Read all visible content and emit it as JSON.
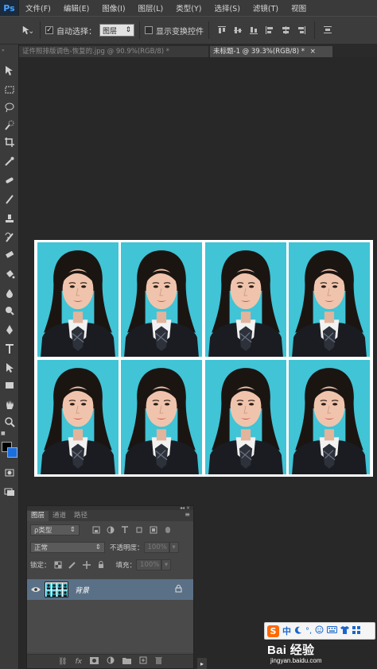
{
  "app": {
    "logo": "Ps"
  },
  "menubar": [
    "文件(F)",
    "编辑(E)",
    "图像(I)",
    "图层(L)",
    "类型(Y)",
    "选择(S)",
    "滤镜(T)",
    "视图"
  ],
  "options": {
    "auto_select_label": "自动选择：",
    "auto_select_value": "图层",
    "show_transform_label": "显示变换控件"
  },
  "tabs": [
    {
      "label": "证件照排版调色-恢复的.jpg @ 90.9%(RGB/8) *",
      "active": false
    },
    {
      "label": "未标题-1 @ 39.3%(RGB/8) *",
      "active": true
    }
  ],
  "layers_panel": {
    "tabs": [
      "图层",
      "通道",
      "路径"
    ],
    "filter_kind": "ρ类型",
    "blend_mode": "正常",
    "opacity_label": "不透明度：",
    "opacity_value": "100%",
    "lock_label": "锁定：",
    "fill_label": "填充：",
    "fill_value": "100%",
    "layer_name": "背景"
  },
  "ime": {
    "lang": "中"
  },
  "watermark": {
    "main": "Bai 经验",
    "url": "jingyan.baidu.com"
  },
  "colors": {
    "photo_bg": "#40c4d6",
    "accent": "#4aa3ff",
    "layer_selected": "#5a7086"
  }
}
